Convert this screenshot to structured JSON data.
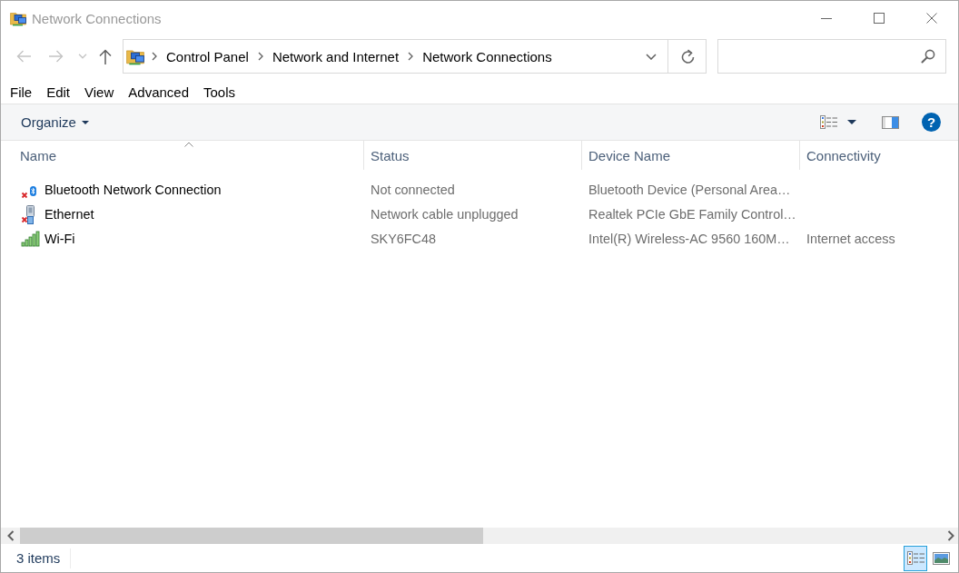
{
  "window": {
    "title": "Network Connections"
  },
  "navigation": {
    "buttons": [
      {
        "kind": "back",
        "disabled": true
      },
      {
        "kind": "forward",
        "disabled": true
      },
      {
        "kind": "recent",
        "disabled": true
      },
      {
        "kind": "up",
        "disabled": false
      }
    ],
    "breadcrumbs": [
      "Control Panel",
      "Network and Internet",
      "Network Connections"
    ]
  },
  "menu_bar": [
    "File",
    "Edit",
    "View",
    "Advanced",
    "Tools"
  ],
  "command_bar": {
    "organize": "Organize",
    "help": "?"
  },
  "table": {
    "columns": [
      {
        "label": "Name",
        "sorted": true
      },
      {
        "label": "Status",
        "sorted": false
      },
      {
        "label": "Device Name",
        "sorted": false
      },
      {
        "label": "Connectivity",
        "sorted": false
      }
    ],
    "rows": [
      {
        "kind": "bluetooth",
        "connected": false,
        "name": "Bluetooth Network Connection",
        "status": "Not connected",
        "device_name": "Bluetooth Device (Personal Area…"
      },
      {
        "kind": "ethernet",
        "connected": false,
        "name": "Ethernet",
        "status": "Network cable unplugged",
        "device_name": "Realtek PCIe GbE Family Control…"
      },
      {
        "kind": "wifi",
        "connected": true,
        "name": "Wi-Fi",
        "status": "SKY6FC48",
        "device_name": "Intel(R) Wireless-AC 9560 160M…",
        "connectivity": "Internet access"
      }
    ]
  },
  "status_bar": {
    "text": "3 items",
    "view_buttons": [
      {
        "kind": "details",
        "selected": true
      },
      {
        "kind": "large_icons",
        "selected": false
      }
    ]
  }
}
